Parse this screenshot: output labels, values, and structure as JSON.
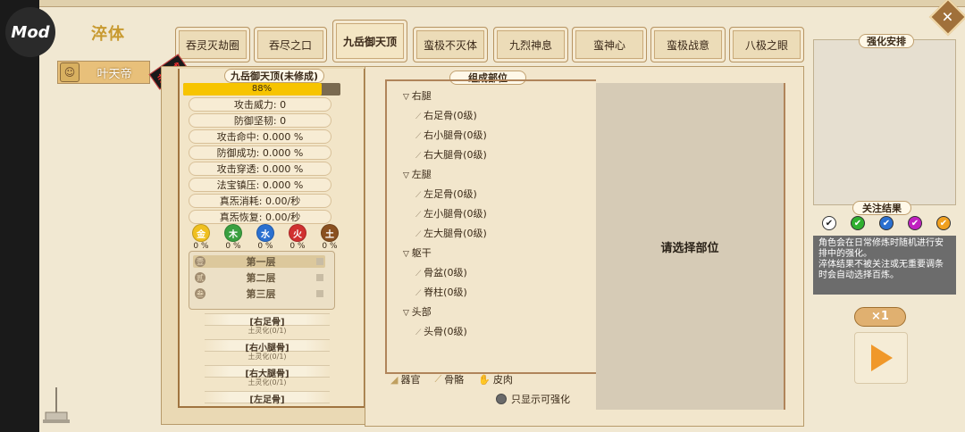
{
  "app": {
    "logo_text": "Mod",
    "title": "淬体"
  },
  "tabs": [
    {
      "label": "吞灵灭劫圈"
    },
    {
      "label": "吞尽之口"
    },
    {
      "label": "九岳御天顶"
    },
    {
      "label": "蛮极不灭体"
    },
    {
      "label": "九烈神息"
    },
    {
      "label": "蛮神心"
    },
    {
      "label": "蛮极战意"
    },
    {
      "label": "八极之眼"
    }
  ],
  "active_tab_index": 2,
  "close_label": "✕",
  "character": {
    "name": "叶天帝",
    "badge": "未修成"
  },
  "left": {
    "title": "九岳御天顶(未修成)",
    "progress": {
      "value": 0.88,
      "label": "88%"
    },
    "stats": [
      "攻击威力: 0",
      "防御坚韧: 0",
      "攻击命中: 0.000 %",
      "防御成功: 0.000 %",
      "攻击穿透: 0.000 %",
      "法宝镇压: 0.000 %",
      "真炁消耗: 0.00/秒",
      "真炁恢复: 0.00/秒"
    ],
    "elements": [
      {
        "name": "金",
        "pct": "0 %",
        "color": "#f0c020"
      },
      {
        "name": "木",
        "pct": "0 %",
        "color": "#3aa040"
      },
      {
        "name": "水",
        "pct": "0 %",
        "color": "#2a70d0"
      },
      {
        "name": "火",
        "pct": "0 %",
        "color": "#d03030"
      },
      {
        "name": "土",
        "pct": "0 %",
        "color": "#8a5020"
      }
    ],
    "layers": [
      {
        "icon": "壹",
        "label": "第一层"
      },
      {
        "icon": "贰",
        "label": "第二层"
      },
      {
        "icon": "叁",
        "label": "第三层"
      }
    ],
    "slots": [
      {
        "title": "[右足骨]",
        "sub": "土灵化(0/1)"
      },
      {
        "title": "[右小腿骨]",
        "sub": "土灵化(0/1)"
      },
      {
        "title": "[右大腿骨]",
        "sub": "土灵化(0/1)"
      },
      {
        "title": "[左足骨]",
        "sub": ""
      }
    ]
  },
  "middle": {
    "title": "组成部位",
    "groups": [
      {
        "label": "右腿",
        "items": [
          "右足骨(0级)",
          "右小腿骨(0级)",
          "右大腿骨(0级)"
        ]
      },
      {
        "label": "左腿",
        "items": [
          "左足骨(0级)",
          "左小腿骨(0级)",
          "左大腿骨(0级)"
        ]
      },
      {
        "label": "躯干",
        "items": [
          "骨盆(0级)",
          "脊柱(0级)"
        ]
      },
      {
        "label": "头部",
        "items": [
          "头骨(0级)"
        ]
      }
    ],
    "placeholder": "请选择部位",
    "filters": [
      {
        "icon": "organ-icon",
        "label": "器官"
      },
      {
        "icon": "bone-icon",
        "label": "骨骼"
      },
      {
        "icon": "skin-icon",
        "label": "皮肉"
      }
    ],
    "only_show_label": "只显示可强化"
  },
  "right": {
    "arrangement_title": "强化安排",
    "focus_title": "关注结果",
    "check_colors": [
      "#ffffff",
      "#30b030",
      "#2a70d0",
      "#c020c0",
      "#f0a020"
    ],
    "description": [
      "角色会在日常修炼时随机进行安排中的强化。",
      "淬体结果不被关注或无重要调条时会自动选择百炼。"
    ],
    "multiplier": "×1"
  }
}
